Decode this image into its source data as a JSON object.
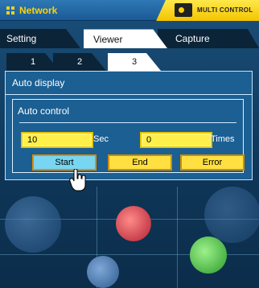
{
  "window": {
    "title": "Network",
    "badge_text": "MULTI CONTROL"
  },
  "tabs": {
    "setting": "Setting",
    "viewer": "Viewer",
    "capture": "Capture"
  },
  "subtabs": [
    "1",
    "2",
    "3"
  ],
  "panel": {
    "title": "Auto display",
    "group_title": "Auto control",
    "sec_value": "10",
    "sec_unit": "Sec",
    "times_value": "0",
    "times_unit": "Times",
    "buttons": {
      "start": "Start",
      "end": "End",
      "error": "Error"
    }
  },
  "colors": {
    "accent_yellow": "#ffd400",
    "panel_blue": "#1b5f93"
  },
  "icons": {
    "menu": "grid-icon",
    "projector": "projector-icon",
    "cursor": "hand-cursor-icon"
  }
}
